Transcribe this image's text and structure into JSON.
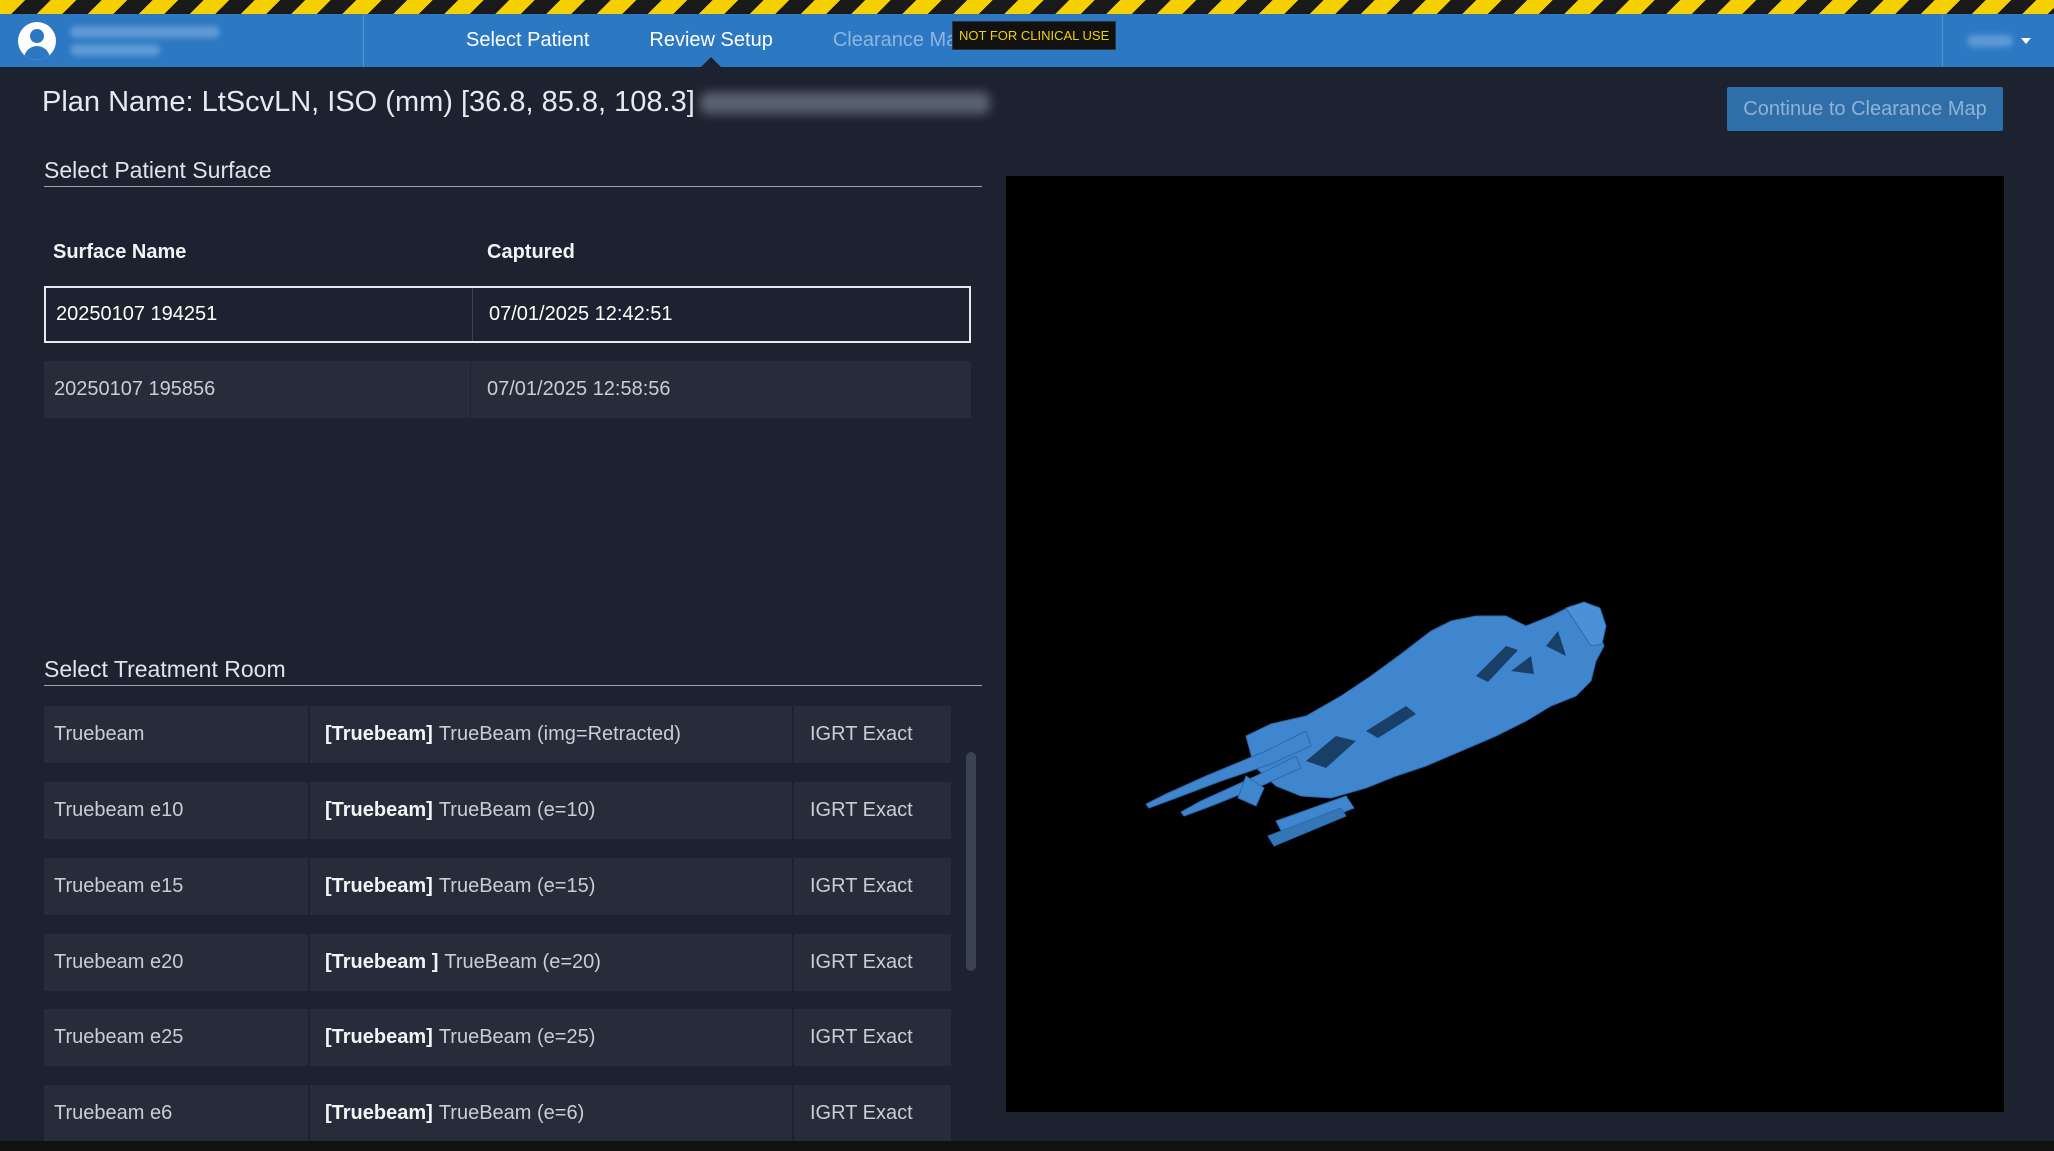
{
  "banner": {
    "not_clinical": "NOT FOR CLINICAL USE"
  },
  "nav": {
    "tabs": [
      {
        "label": "Select Patient",
        "state": "enabled"
      },
      {
        "label": "Review Setup",
        "state": "active"
      },
      {
        "label": "Clearance Map",
        "state": "disabled"
      }
    ]
  },
  "header": {
    "plan_title": "Plan Name: LtScvLN, ISO (mm) [36.8, 85.8, 108.3]",
    "continue_label": "Continue to Clearance Map"
  },
  "surfaces": {
    "section_title": "Select Patient Surface",
    "columns": [
      "Surface Name",
      "Captured"
    ],
    "rows": [
      {
        "name": "20250107 194251",
        "captured": "07/01/2025 12:42:51",
        "selected": true
      },
      {
        "name": "20250107 195856",
        "captured": "07/01/2025 12:58:56",
        "selected": false
      }
    ]
  },
  "rooms": {
    "section_title": "Select Treatment Room",
    "rows": [
      {
        "name": "Truebeam",
        "machine_tag": "[Truebeam]",
        "machine": "TrueBeam (img=Retracted)",
        "mode": "IGRT Exact"
      },
      {
        "name": "Truebeam e10",
        "machine_tag": "[Truebeam]",
        "machine": "TrueBeam (e=10)",
        "mode": "IGRT Exact"
      },
      {
        "name": "Truebeam e15",
        "machine_tag": "[Truebeam]",
        "machine": "TrueBeam (e=15)",
        "mode": "IGRT Exact"
      },
      {
        "name": "Truebeam e20",
        "machine_tag": "[Truebeam ]",
        "machine": "TrueBeam (e=20)",
        "mode": "IGRT Exact"
      },
      {
        "name": "Truebeam e25",
        "machine_tag": "[Truebeam]",
        "machine": "TrueBeam (e=25)",
        "mode": "IGRT Exact"
      },
      {
        "name": "Truebeam e6",
        "machine_tag": "[Truebeam]",
        "machine": "TrueBeam (e=6)",
        "mode": "IGRT Exact"
      }
    ]
  },
  "icons": {
    "user": "user-avatar-icon",
    "menu": "caret-down-icon"
  },
  "colors": {
    "topbar": "#2c78c3",
    "background": "#1d2230",
    "surface_mesh": "#3f86cf",
    "warning_stripe": "#f5d000"
  }
}
